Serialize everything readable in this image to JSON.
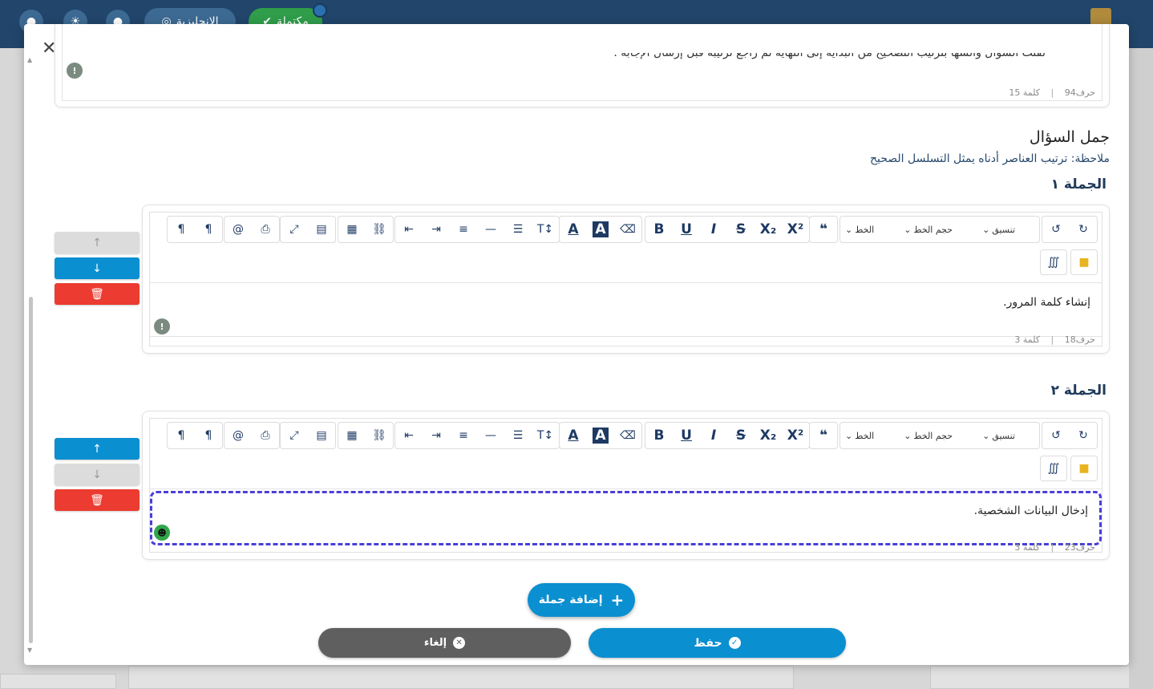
{
  "topbar": {
    "lang_label": "الإنجليزية",
    "status_label": "مكتملة"
  },
  "modal": {
    "top_card": {
      "partial_text": "لفتت السؤال والسها بترتيب التصحيح من البداية إلى النهاية ثم راجع ترتيبه قبل إرسال الإجابة .",
      "char_count": "حرف94",
      "word_count": "كلمة 15"
    },
    "section_title": "جمل السؤال",
    "note": "ملاحظة: ترتيب العناصر أدناه يمثل التسلسل الصحيح",
    "sentences": [
      {
        "label": "الجملة ١",
        "text": "إنشاء كلمة المرور.",
        "char_count": "حرف18",
        "word_count": "كلمة 3"
      },
      {
        "label": "الجملة ٢",
        "text": "إدخال البيانات الشخصية.",
        "char_count": "حرف23",
        "word_count": "كلمة 3"
      }
    ],
    "toolbar": {
      "format_label": "تنسيق",
      "font_size_label": "حجم الخط",
      "font_label": "الخط"
    },
    "add_sentence_label": "إضافة جملة",
    "save_label": "حفظ",
    "cancel_label": "إلغاء"
  },
  "colors": {
    "primary": "#0a8fd1",
    "danger": "#ec3b30",
    "topbar": "#21456b",
    "active_border": "#4b3fd6"
  }
}
